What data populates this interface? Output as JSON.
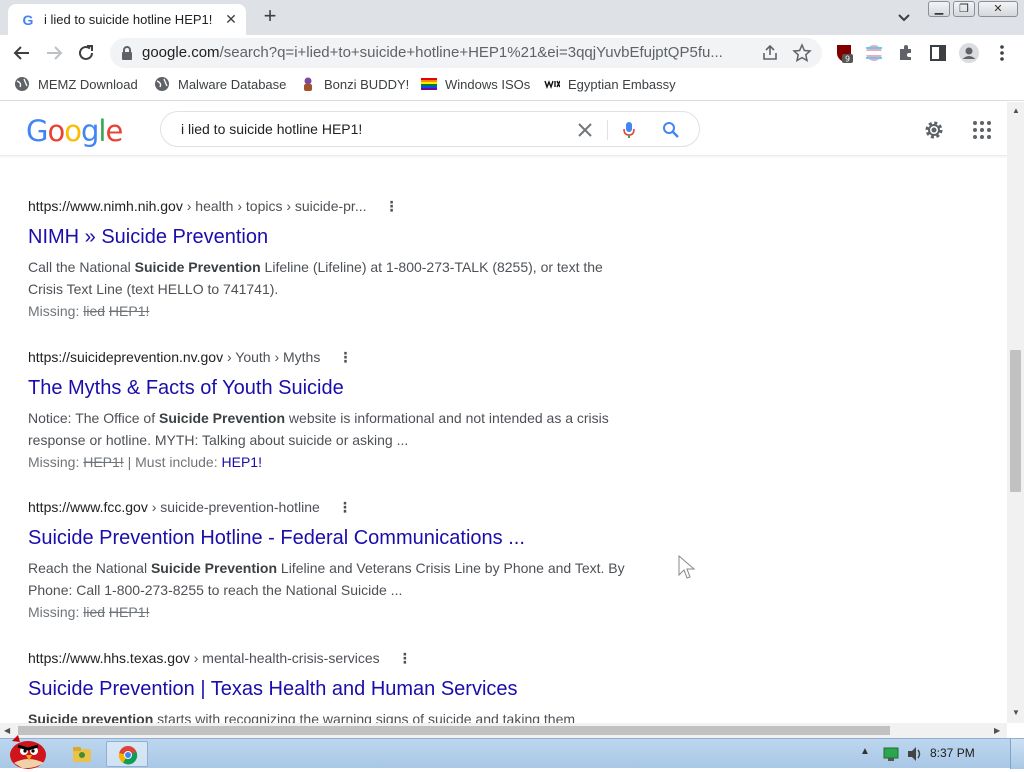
{
  "browser": {
    "tab_title": "i lied to suicide hotline HEP1!",
    "url_host": "google.com",
    "url_rest": "/search?q=i+lied+to+suicide+hotline+HEP1%21&ei=3qqjYuvbEfujptQP5fu...",
    "extension_badge": "9"
  },
  "bookmarks": [
    {
      "label": "MEMZ Download",
      "icon": "globe-icon"
    },
    {
      "label": "Malware Database",
      "icon": "globe-icon"
    },
    {
      "label": "Bonzi BUDDY!",
      "icon": "bonzi-icon"
    },
    {
      "label": "Windows ISOs",
      "icon": "rainbow-flag-icon"
    },
    {
      "label": "Egyptian Embassy",
      "icon": "wix-icon"
    }
  ],
  "google": {
    "logo": "Google",
    "query": "i lied to suicide hotline HEP1!"
  },
  "results": [
    {
      "domain": "https://www.nimh.nih.gov",
      "path": " › health › topics › suicide-pr...",
      "title": "NIMH » Suicide Prevention",
      "snippet_html": "Call the National <b>Suicide Prevention</b> Lifeline (Lifeline) at 1-800-273-TALK (8255), or text the Crisis Text Line (text HELLO to 741741).",
      "missing_label": "Missing: ",
      "missing_terms": [
        "lied",
        "HEP1!"
      ],
      "must_include": ""
    },
    {
      "domain": "https://suicideprevention.nv.gov",
      "path": " › Youth › Myths",
      "title": "The Myths & Facts of Youth Suicide",
      "snippet_html": "Notice: The Office of <b>Suicide Prevention</b> website is informational and not intended as a crisis response or hotline. MYTH: Talking about suicide or asking ...",
      "missing_label": "Missing: ",
      "missing_terms": [
        "HEP1!"
      ],
      "must_include_label": " | Must include: ",
      "must_include": "HEP1!"
    },
    {
      "domain": "https://www.fcc.gov",
      "path": " › suicide-prevention-hotline",
      "title": "Suicide Prevention Hotline - Federal Communications ...",
      "snippet_html": "Reach the National <b>Suicide Prevention</b> Lifeline and Veterans Crisis Line by Phone and Text. By Phone: Call 1-800-273-8255 to reach the National Suicide ...",
      "missing_label": "Missing: ",
      "missing_terms": [
        "lied",
        "HEP1!"
      ],
      "must_include": ""
    },
    {
      "domain": "https://www.hhs.texas.gov",
      "path": " › mental-health-crisis-services",
      "title": "Suicide Prevention | Texas Health and Human Services",
      "snippet_html": "<b>Suicide prevention</b> starts with recognizing the warning signs of suicide and taking them",
      "missing_label": "",
      "missing_terms": [],
      "must_include": ""
    }
  ],
  "taskbar": {
    "clock": "8:37 PM"
  },
  "colors": {
    "link": "#1a0dab",
    "accent": "#4285f4"
  }
}
